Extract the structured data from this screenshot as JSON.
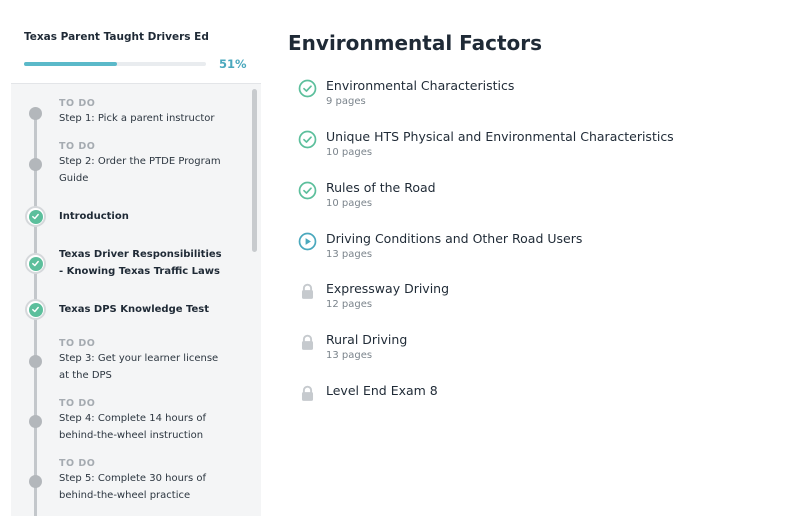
{
  "sidebar": {
    "course_title": "Texas Parent Taught Drivers Ed",
    "progress_percent": 51,
    "progress_label": "51%",
    "steps": [
      {
        "status": "todo",
        "tag": "TO DO",
        "label": "Step 1: Pick a parent instructor"
      },
      {
        "status": "todo",
        "tag": "TO DO",
        "label": "Step 2: Order the PTDE Program Guide"
      },
      {
        "status": "complete",
        "tag": "",
        "label": "Introduction"
      },
      {
        "status": "complete",
        "tag": "",
        "label": "Texas Driver Responsibilities - Knowing Texas Traffic Laws"
      },
      {
        "status": "complete",
        "tag": "",
        "label": "Texas DPS Knowledge Test"
      },
      {
        "status": "todo",
        "tag": "TO DO",
        "label": "Step 3: Get your learner license at the DPS"
      },
      {
        "status": "todo",
        "tag": "TO DO",
        "label": "Step 4: Complete 14 hours of behind-the-wheel instruction"
      },
      {
        "status": "todo",
        "tag": "TO DO",
        "label": "Step 5: Complete 30 hours of behind-the-wheel practice"
      }
    ]
  },
  "main": {
    "title": "Environmental Factors",
    "lessons": [
      {
        "status": "complete",
        "icon": "check-circle-icon",
        "title": "Environmental Characteristics",
        "pages": "9 pages"
      },
      {
        "status": "complete",
        "icon": "check-circle-icon",
        "title": "Unique HTS Physical and Environmental Characteristics",
        "pages": "10 pages"
      },
      {
        "status": "complete",
        "icon": "check-circle-icon",
        "title": "Rules of the Road",
        "pages": "10 pages"
      },
      {
        "status": "in-progress",
        "icon": "play-circle-icon",
        "title": "Driving Conditions and Other Road Users",
        "pages": "13 pages"
      },
      {
        "status": "locked",
        "icon": "lock-icon",
        "title": "Expressway Driving",
        "pages": "12 pages"
      },
      {
        "status": "locked",
        "icon": "lock-icon",
        "title": "Rural Driving",
        "pages": "13 pages"
      },
      {
        "status": "locked",
        "icon": "lock-icon",
        "title": "Level End Exam 8",
        "pages": ""
      }
    ]
  },
  "colors": {
    "accent": "#4aa8bd",
    "progress": "#5bb9c9",
    "complete": "#5cbf9c",
    "inactive": "#b3b7bb",
    "lock": "#c6cace"
  }
}
